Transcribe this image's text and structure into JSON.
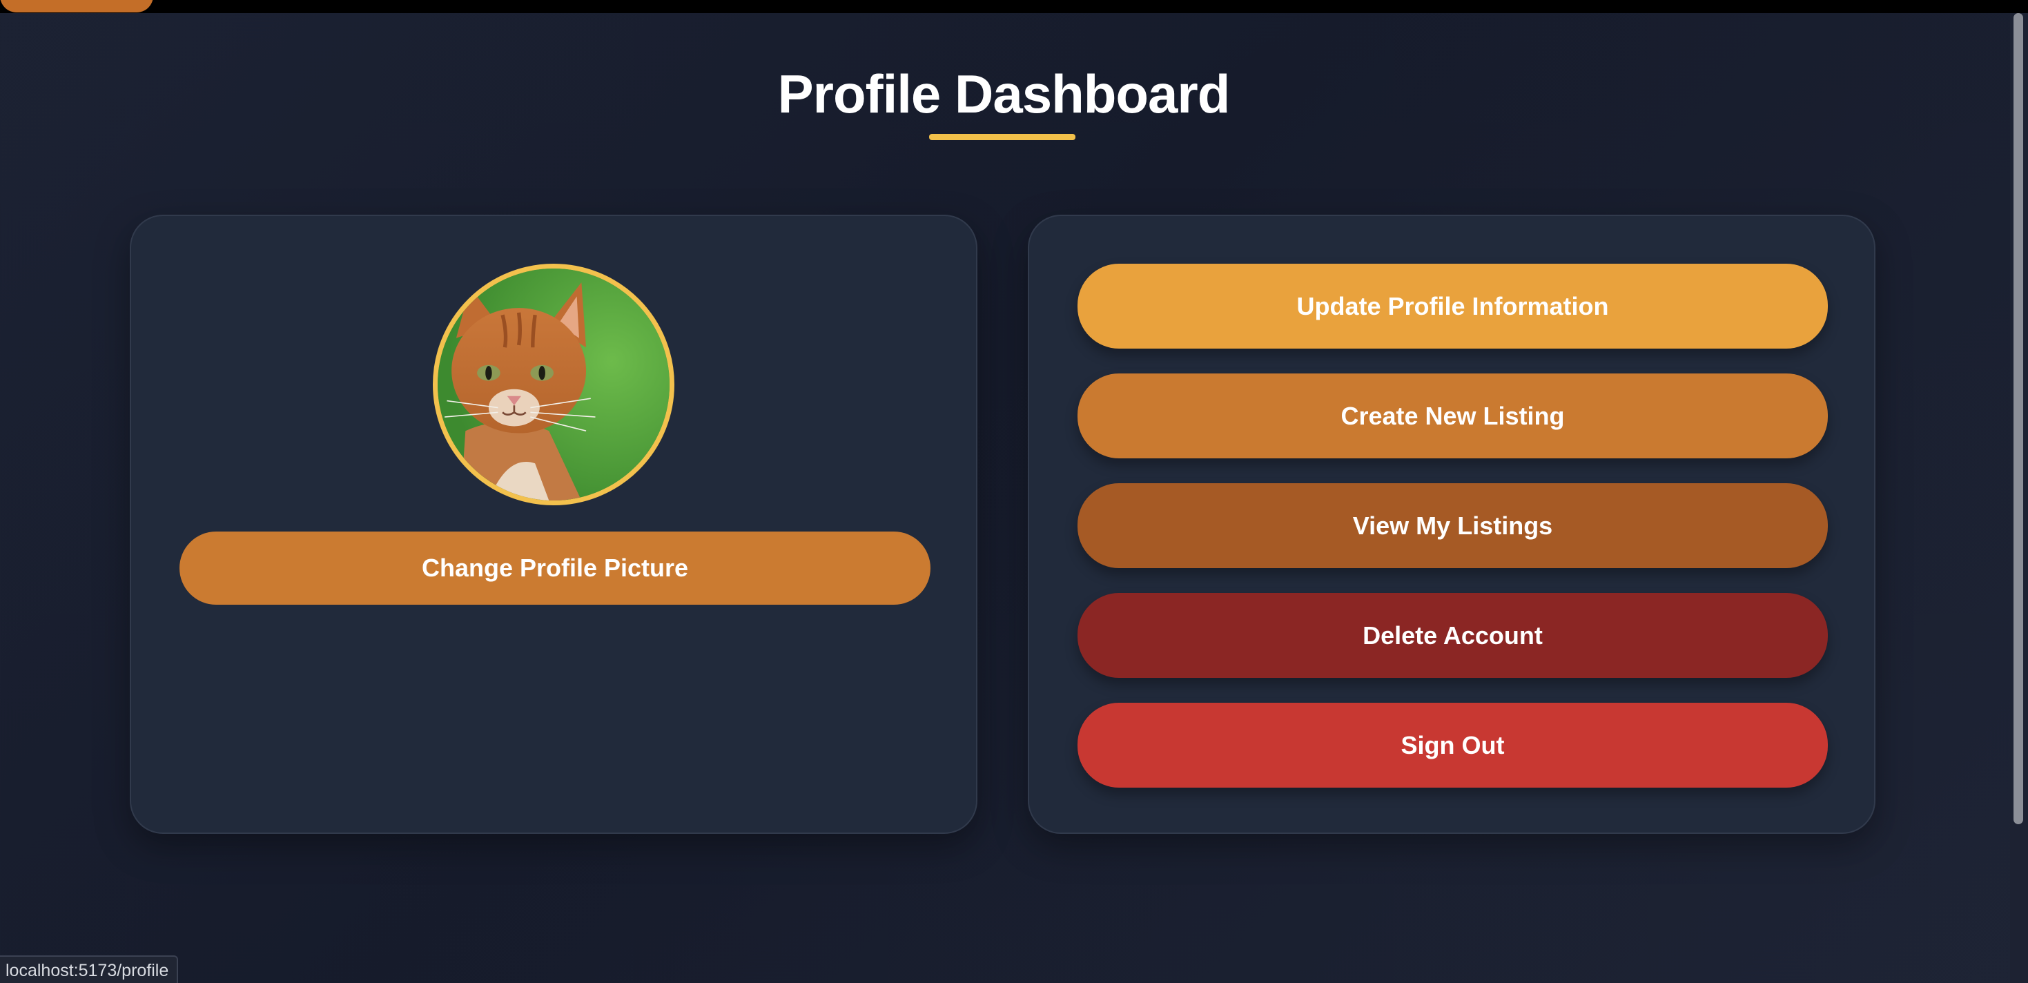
{
  "page": {
    "title": "Profile Dashboard",
    "accent_color": "#f2c04a",
    "background_color": "#1a1f2e"
  },
  "profile": {
    "avatar_icon": "cat-photo",
    "change_picture_label": "Change Profile Picture"
  },
  "actions": {
    "update_profile_label": "Update Profile Information",
    "create_listing_label": "Create New Listing",
    "view_listings_label": "View My Listings",
    "delete_account_label": "Delete Account",
    "sign_out_label": "Sign Out",
    "colors": {
      "update": "#e9a23d",
      "create": "#ca7a30",
      "view": "#a65a25",
      "delete": "#8b2624",
      "sign_out": "#c83832"
    }
  },
  "statusbar": {
    "url": "localhost:5173/profile"
  }
}
